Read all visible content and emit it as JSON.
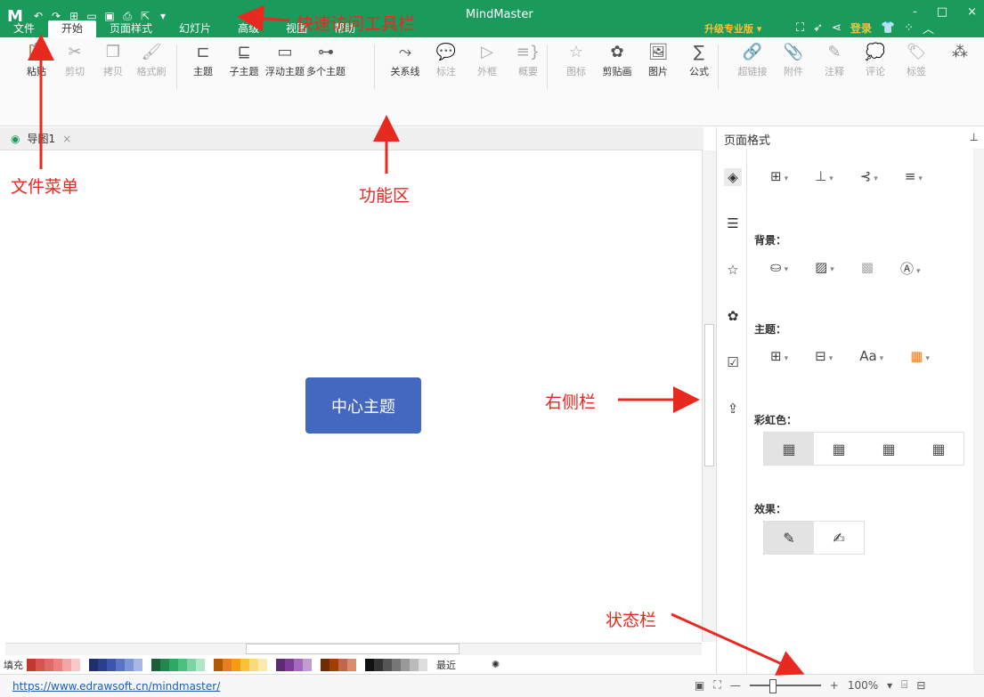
{
  "app_title": "MindMaster",
  "window_controls": [
    "-",
    "□",
    "×"
  ],
  "quick_access": {
    "logo": "M",
    "icons": [
      "undo-icon",
      "redo-icon",
      "new-icon",
      "open-icon",
      "save-icon",
      "print-icon",
      "export-icon",
      "customize-icon"
    ]
  },
  "menu_tabs": [
    "文件",
    "开始",
    "页面样式",
    "幻灯片",
    "高级",
    "视图",
    "帮助"
  ],
  "active_tab": "开始",
  "upgrade_label": "升级专业版 ▾",
  "login_label": "登录",
  "ribbon": {
    "buttons": [
      {
        "label": "粘贴",
        "icon": "paste-icon",
        "glyph": "📋",
        "disabled": false
      },
      {
        "label": "剪切",
        "icon": "cut-icon",
        "glyph": "✂",
        "disabled": true
      },
      {
        "label": "拷贝",
        "icon": "copy-icon",
        "glyph": "❐",
        "disabled": true
      },
      {
        "label": "格式刷",
        "icon": "format-painter-icon",
        "glyph": "🖌",
        "disabled": true
      },
      {
        "label": "主题",
        "icon": "topic-icon",
        "glyph": "⊏",
        "disabled": false
      },
      {
        "label": "子主题",
        "icon": "subtopic-icon",
        "glyph": "⊑",
        "disabled": false
      },
      {
        "label": "浮动主题",
        "icon": "floating-topic-icon",
        "glyph": "▭",
        "disabled": false
      },
      {
        "label": "多个主题",
        "icon": "multiple-topics-icon",
        "glyph": "⊶",
        "disabled": false
      },
      {
        "label": "关系线",
        "icon": "relationship-icon",
        "glyph": "⤳",
        "disabled": false
      },
      {
        "label": "标注",
        "icon": "callout-icon",
        "glyph": "💬",
        "disabled": true
      },
      {
        "label": "外框",
        "icon": "boundary-icon",
        "glyph": "▷",
        "disabled": true
      },
      {
        "label": "概要",
        "icon": "summary-icon",
        "glyph": "≡}",
        "disabled": true
      },
      {
        "label": "图标",
        "icon": "mark-icon",
        "glyph": "☆",
        "disabled": true
      },
      {
        "label": "剪贴画",
        "icon": "clipart-icon",
        "glyph": "✿",
        "disabled": false
      },
      {
        "label": "图片",
        "icon": "picture-icon",
        "glyph": "🖼",
        "disabled": false
      },
      {
        "label": "公式",
        "icon": "formula-icon",
        "glyph": "∑",
        "disabled": false
      },
      {
        "label": "超链接",
        "icon": "hyperlink-icon",
        "glyph": "🔗",
        "disabled": true
      },
      {
        "label": "附件",
        "icon": "attachment-icon",
        "glyph": "📎",
        "disabled": true
      },
      {
        "label": "注释",
        "icon": "note-icon",
        "glyph": "✎",
        "disabled": true
      },
      {
        "label": "评论",
        "icon": "comment-icon",
        "glyph": "💭",
        "disabled": true
      },
      {
        "label": "标签",
        "icon": "tag-icon",
        "glyph": "🏷",
        "disabled": true
      }
    ]
  },
  "document_tab": {
    "label": "导图1",
    "close": "×"
  },
  "central_topic": "中心主题",
  "fill_label": "填充",
  "recent_label": "最近",
  "status": {
    "link": "https://www.edrawsoft.cn/mindmaster/",
    "zoom": "100%"
  },
  "right_panel": {
    "title": "页面格式",
    "background_label": "背景：",
    "theme_label": "主题：",
    "rainbow_label": "彩虹色：",
    "effects_label": "效果："
  },
  "annotations": {
    "qat": "快速访问工具栏",
    "file_menu": "文件菜单",
    "ribbon": "功能区",
    "right_panel": "右侧栏",
    "status_bar": "状态栏"
  },
  "colors": {
    "title_bar": "#1a9b5c",
    "central_topic": "#4467c0",
    "annotation": "#e8291f",
    "upgrade": "#f6c33b"
  }
}
